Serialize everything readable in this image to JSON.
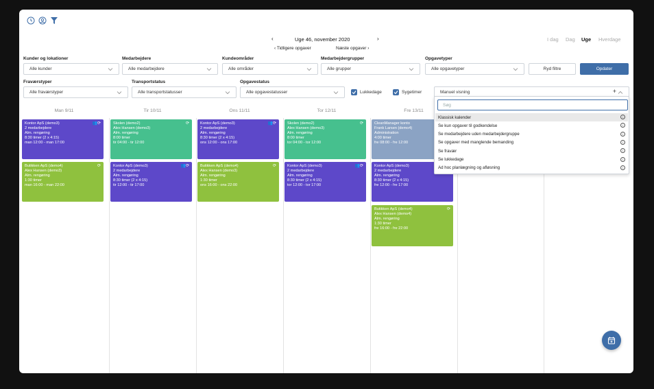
{
  "toolbar": {
    "week_title": "Uge 46, november 2020",
    "prev_tasks": "Tidligere opgaver",
    "next_tasks": "Næste opgaver",
    "views": [
      "I dag",
      "Dag",
      "Uge",
      "Hverdage"
    ],
    "active_view": "Uge"
  },
  "filters": {
    "row1": [
      {
        "label": "Kunder og lokationer",
        "value": "Alle kunder"
      },
      {
        "label": "Medarbejdere",
        "value": "Alle medarbejdere"
      },
      {
        "label": "Kundeområder",
        "value": "Alle områder"
      },
      {
        "label": "Medarbejdergrupper",
        "value": "Alle grupper"
      },
      {
        "label": "Opgavetyper",
        "value": "Alle opgavetyper"
      }
    ],
    "row2": [
      {
        "label": "Fraværstyper",
        "value": "Alle fraværstyper"
      },
      {
        "label": "Transportstatus",
        "value": "Alle transportstatusser"
      },
      {
        "label": "Opgavestatus",
        "value": "Alle opgavestatusser"
      }
    ],
    "reset_label": "Ryd filtre",
    "update_label": "Opdater",
    "closed_days_label": "Lukkedage",
    "sick_label": "Sygetimer",
    "view_select_value": "Manuel visning"
  },
  "view_dropdown": {
    "search_placeholder": "Søg",
    "options": [
      "Klassisk kalender",
      "Se kun opgaver til godkendelse",
      "Se medarbejdere uden medarbejdergruppe",
      "Se opgaver med manglende bemanding",
      "Se fravær",
      "Se lukkedage",
      "Ad hoc planlægning og afløsning"
    ]
  },
  "days": [
    "Man 9/11",
    "Tir 10/11",
    "Ons 11/11",
    "Tor 12/11",
    "Fre 13/11"
  ],
  "cards": [
    {
      "col": 0,
      "row": 0,
      "color": "purple",
      "icon": "group-repeat-icon",
      "lines": [
        "Kontor ApS (demo3)",
        "2 medarbejdere",
        "Alm. rengøring",
        "8:30 timer (2 x 4:15)",
        "man 12:00 - man 17:00"
      ]
    },
    {
      "col": 0,
      "row": 1,
      "color": "lime",
      "icon": "repeat-icon",
      "lines": [
        "Butikken ApS (demo4)",
        "Alex Hansen (demo3)",
        "Alm. rengøring",
        "1:30 timer",
        "man 16:00 - man 22:00"
      ]
    },
    {
      "col": 1,
      "row": 0,
      "color": "green",
      "icon": "repeat-icon",
      "lines": [
        "Skolen (demo2)",
        "Alex Hansen (demo3)",
        "Alm. rengøring",
        "8:00 timer",
        "tir 04:00 - tir 12:00"
      ]
    },
    {
      "col": 1,
      "row": 1,
      "color": "purple",
      "icon": "group-repeat-icon",
      "lines": [
        "Kontor ApS (demo3)",
        "2 medarbejdere",
        "Alm. rengøring",
        "8:30 timer (2 x 4:15)",
        "tir 12:00 - tir 17:00"
      ]
    },
    {
      "col": 2,
      "row": 0,
      "color": "purple",
      "icon": "group-repeat-icon",
      "lines": [
        "Kontor ApS (demo3)",
        "2 medarbejdere",
        "Alm. rengøring",
        "8:30 timer (2 x 4:15)",
        "ons 12:00 - ons 17:00"
      ]
    },
    {
      "col": 2,
      "row": 1,
      "color": "lime",
      "icon": "repeat-icon",
      "lines": [
        "Butikken ApS (demo4)",
        "Alex Hansen (demo3)",
        "Alm. rengøring",
        "1:30 timer",
        "ons 16:00 - ons 22:00"
      ]
    },
    {
      "col": 3,
      "row": 0,
      "color": "green",
      "icon": "repeat-icon",
      "lines": [
        "Skolen (demo2)",
        "Alex Hansen (demo3)",
        "Alm. rengøring",
        "8:00 timer",
        "tor 04:00 - tor 12:00"
      ]
    },
    {
      "col": 3,
      "row": 1,
      "color": "purple",
      "icon": "group-repeat-icon",
      "lines": [
        "Kontor ApS (demo3)",
        "2 medarbejdere",
        "Alm. rengøring",
        "8:30 timer (2 x 4:15)",
        "tor 12:00 - tor 17:00"
      ]
    },
    {
      "col": 4,
      "row": 0,
      "color": "slate",
      "icon": "",
      "lines": [
        "CleanManager konto",
        "Frank Larsen (demo4)",
        "Administration",
        "4:00 timer",
        "fre 08:00 - fre 12:00"
      ]
    },
    {
      "col": 4,
      "row": 1,
      "color": "purple",
      "icon": "group-repeat-icon",
      "lines": [
        "Kontor ApS (demo3)",
        "2 medarbejdere",
        "Alm. rengøring",
        "8:30 timer (2 x 4:15)",
        "fre 12:00 - fre 17:00"
      ]
    },
    {
      "col": 4,
      "row": 2,
      "color": "lime",
      "icon": "repeat-icon",
      "lines": [
        "Butikken ApS (demo4)",
        "Alex Hansen (demo4)",
        "Alm. rengøring",
        "1:30 timer",
        "fre 16:00 - fre 22:00"
      ]
    }
  ],
  "colors": {
    "accent": "#3f6ea8",
    "purple": "#5d48c9",
    "green": "#46c08e",
    "lime": "#8fc13e",
    "slate": "#8ba3c4"
  }
}
